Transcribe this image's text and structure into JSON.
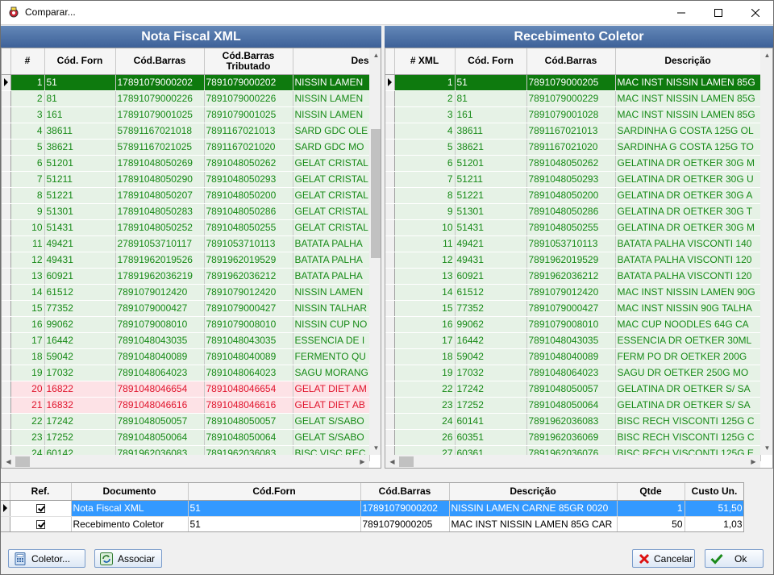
{
  "window": {
    "title": "Comparar..."
  },
  "left": {
    "title": "Nota Fiscal XML",
    "columns": [
      "#",
      "Cód. Forn",
      "Cód.Barras",
      "Cód.Barras Tributado",
      "Des"
    ],
    "rows": [
      {
        "n": "1",
        "forn": "51",
        "barras": "17891079000202",
        "trib": "7891079000202",
        "desc": "NISSIN LAMEN",
        "state": "sel"
      },
      {
        "n": "2",
        "forn": "81",
        "barras": "17891079000226",
        "trib": "7891079000226",
        "desc": "NISSIN LAMEN",
        "state": "row"
      },
      {
        "n": "3",
        "forn": "161",
        "barras": "17891079001025",
        "trib": "7891079001025",
        "desc": "NISSIN LAMEN",
        "state": "row"
      },
      {
        "n": "4",
        "forn": "38611",
        "barras": "57891167021018",
        "trib": "7891167021013",
        "desc": "SARD GDC OLE",
        "state": "row"
      },
      {
        "n": "5",
        "forn": "38621",
        "barras": "57891167021025",
        "trib": "7891167021020",
        "desc": "SARD GDC MO",
        "state": "row"
      },
      {
        "n": "6",
        "forn": "51201",
        "barras": "17891048050269",
        "trib": "7891048050262",
        "desc": "GELAT CRISTAL",
        "state": "row"
      },
      {
        "n": "7",
        "forn": "51211",
        "barras": "17891048050290",
        "trib": "7891048050293",
        "desc": "GELAT CRISTAL",
        "state": "row"
      },
      {
        "n": "8",
        "forn": "51221",
        "barras": "17891048050207",
        "trib": "7891048050200",
        "desc": "GELAT CRISTAL",
        "state": "row"
      },
      {
        "n": "9",
        "forn": "51301",
        "barras": "17891048050283",
        "trib": "7891048050286",
        "desc": "GELAT CRISTAL",
        "state": "row"
      },
      {
        "n": "10",
        "forn": "51431",
        "barras": "17891048050252",
        "trib": "7891048050255",
        "desc": "GELAT CRISTAL",
        "state": "row"
      },
      {
        "n": "11",
        "forn": "49421",
        "barras": "27891053710117",
        "trib": "7891053710113",
        "desc": "BATATA PALHA",
        "state": "row"
      },
      {
        "n": "12",
        "forn": "49431",
        "barras": "17891962019526",
        "trib": "7891962019529",
        "desc": "BATATA PALHA",
        "state": "row"
      },
      {
        "n": "13",
        "forn": "60921",
        "barras": "17891962036219",
        "trib": "7891962036212",
        "desc": "BATATA PALHA",
        "state": "row"
      },
      {
        "n": "14",
        "forn": "61512",
        "barras": "7891079012420",
        "trib": "7891079012420",
        "desc": "NISSIN LAMEN",
        "state": "row"
      },
      {
        "n": "15",
        "forn": "77352",
        "barras": "7891079000427",
        "trib": "7891079000427",
        "desc": "NISSIN TALHAR",
        "state": "row"
      },
      {
        "n": "16",
        "forn": "99062",
        "barras": "7891079008010",
        "trib": "7891079008010",
        "desc": "NISSIN CUP NO",
        "state": "row"
      },
      {
        "n": "17",
        "forn": "16442",
        "barras": "7891048043035",
        "trib": "7891048043035",
        "desc": "ESSENCIA DE I",
        "state": "row"
      },
      {
        "n": "18",
        "forn": "59042",
        "barras": "7891048040089",
        "trib": "7891048040089",
        "desc": "FERMENTO QU",
        "state": "row"
      },
      {
        "n": "19",
        "forn": "17032",
        "barras": "7891048064023",
        "trib": "7891048064023",
        "desc": "SAGU MORANG",
        "state": "row"
      },
      {
        "n": "20",
        "forn": "16822",
        "barras": "7891048046654",
        "trib": "7891048046654",
        "desc": "GELAT DIET AM",
        "state": "err"
      },
      {
        "n": "21",
        "forn": "16832",
        "barras": "7891048046616",
        "trib": "7891048046616",
        "desc": "GELAT DIET AB",
        "state": "err"
      },
      {
        "n": "22",
        "forn": "17242",
        "barras": "7891048050057",
        "trib": "7891048050057",
        "desc": "GELAT S/SABO",
        "state": "row"
      },
      {
        "n": "23",
        "forn": "17252",
        "barras": "7891048050064",
        "trib": "7891048050064",
        "desc": "GELAT S/SABO",
        "state": "row"
      },
      {
        "n": "24",
        "forn": "60142",
        "barras": "7891962036083",
        "trib": "7891962036083",
        "desc": "BISC VISC REC",
        "state": "row"
      }
    ]
  },
  "right": {
    "title": "Recebimento Coletor",
    "columns": [
      "# XML",
      "Cód. Forn",
      "Cód.Barras",
      "Descrição"
    ],
    "rows": [
      {
        "n": "1",
        "forn": "51",
        "barras": "7891079000205",
        "desc": "MAC INST NISSIN LAMEN 85G",
        "state": "sel"
      },
      {
        "n": "2",
        "forn": "81",
        "barras": "7891079000229",
        "desc": "MAC INST NISSIN LAMEN 85G",
        "state": "row"
      },
      {
        "n": "3",
        "forn": "161",
        "barras": "7891079001028",
        "desc": "MAC INST NISSIN LAMEN 85G",
        "state": "row"
      },
      {
        "n": "4",
        "forn": "38611",
        "barras": "7891167021013",
        "desc": "SARDINHA G COSTA 125G OL",
        "state": "row"
      },
      {
        "n": "5",
        "forn": "38621",
        "barras": "7891167021020",
        "desc": "SARDINHA G COSTA 125G TO",
        "state": "row"
      },
      {
        "n": "6",
        "forn": "51201",
        "barras": "7891048050262",
        "desc": "GELATINA DR OETKER 30G M",
        "state": "row"
      },
      {
        "n": "7",
        "forn": "51211",
        "barras": "7891048050293",
        "desc": "GELATINA DR OETKER 30G U",
        "state": "row"
      },
      {
        "n": "8",
        "forn": "51221",
        "barras": "7891048050200",
        "desc": "GELATINA DR OETKER 30G A",
        "state": "row"
      },
      {
        "n": "9",
        "forn": "51301",
        "barras": "7891048050286",
        "desc": "GELATINA DR OETKER 30G T",
        "state": "row"
      },
      {
        "n": "10",
        "forn": "51431",
        "barras": "7891048050255",
        "desc": "GELATINA DR OETKER 30G M",
        "state": "row"
      },
      {
        "n": "11",
        "forn": "49421",
        "barras": "7891053710113",
        "desc": "BATATA PALHA VISCONTI 140",
        "state": "row"
      },
      {
        "n": "12",
        "forn": "49431",
        "barras": "7891962019529",
        "desc": "BATATA PALHA VISCONTI 120",
        "state": "row"
      },
      {
        "n": "13",
        "forn": "60921",
        "barras": "7891962036212",
        "desc": "BATATA PALHA VISCONTI 120",
        "state": "row"
      },
      {
        "n": "14",
        "forn": "61512",
        "barras": "7891079012420",
        "desc": "MAC INST NISSIN LAMEN 90G",
        "state": "row"
      },
      {
        "n": "15",
        "forn": "77352",
        "barras": "7891079000427",
        "desc": "MAC INST NISSIN 90G TALHA",
        "state": "row"
      },
      {
        "n": "16",
        "forn": "99062",
        "barras": "7891079008010",
        "desc": "MAC CUP NOODLES 64G CA",
        "state": "row"
      },
      {
        "n": "17",
        "forn": "16442",
        "barras": "7891048043035",
        "desc": "ESSENCIA DR OETKER 30ML",
        "state": "row"
      },
      {
        "n": "18",
        "forn": "59042",
        "barras": "7891048040089",
        "desc": "FERM PO DR OETKER 200G",
        "state": "row"
      },
      {
        "n": "19",
        "forn": "17032",
        "barras": "7891048064023",
        "desc": "SAGU DR OETKER 250G MO",
        "state": "row"
      },
      {
        "n": "22",
        "forn": "17242",
        "barras": "7891048050057",
        "desc": "GELATINA DR OETKER S/ SA",
        "state": "row"
      },
      {
        "n": "23",
        "forn": "17252",
        "barras": "7891048050064",
        "desc": "GELATINA DR OETKER S/ SA",
        "state": "row"
      },
      {
        "n": "24",
        "forn": "60141",
        "barras": "7891962036083",
        "desc": "BISC RECH VISCONTI 125G C",
        "state": "row"
      },
      {
        "n": "26",
        "forn": "60351",
        "barras": "7891962036069",
        "desc": "BISC RECH VISCONTI 125G C",
        "state": "row"
      },
      {
        "n": "27",
        "forn": "60361",
        "barras": "7891962036076",
        "desc": "BISC RECH VISCONTI 125G E",
        "state": "row"
      }
    ]
  },
  "bottom": {
    "columns": [
      "Ref.",
      "Documento",
      "Cód.Forn",
      "Cód.Barras",
      "Descrição",
      "Qtde",
      "Custo Un."
    ],
    "rows": [
      {
        "doc": "Nota Fiscal XML",
        "forn": "51",
        "barras": "17891079000202",
        "desc": "NISSIN LAMEN CARNE 85GR 0020",
        "qtde": "1",
        "custo": "51,50",
        "selected": true
      },
      {
        "doc": "Recebimento Coletor",
        "forn": "51",
        "barras": "7891079000205",
        "desc": "MAC INST NISSIN LAMEN 85G CAR",
        "qtde": "50",
        "custo": "1,03",
        "selected": false
      }
    ]
  },
  "buttons": {
    "coletor": "Coletor...",
    "associar": "Associar",
    "cancelar": "Cancelar",
    "ok": "Ok"
  },
  "colors": {
    "title_bar": "#3d6198",
    "row_text": "#178a17",
    "row_bg": "#e6f2e6",
    "selected_row": "#0e7a0e",
    "error_text": "#e0142c",
    "error_bg": "#fde2e6",
    "bottom_selected": "#3399ff"
  }
}
